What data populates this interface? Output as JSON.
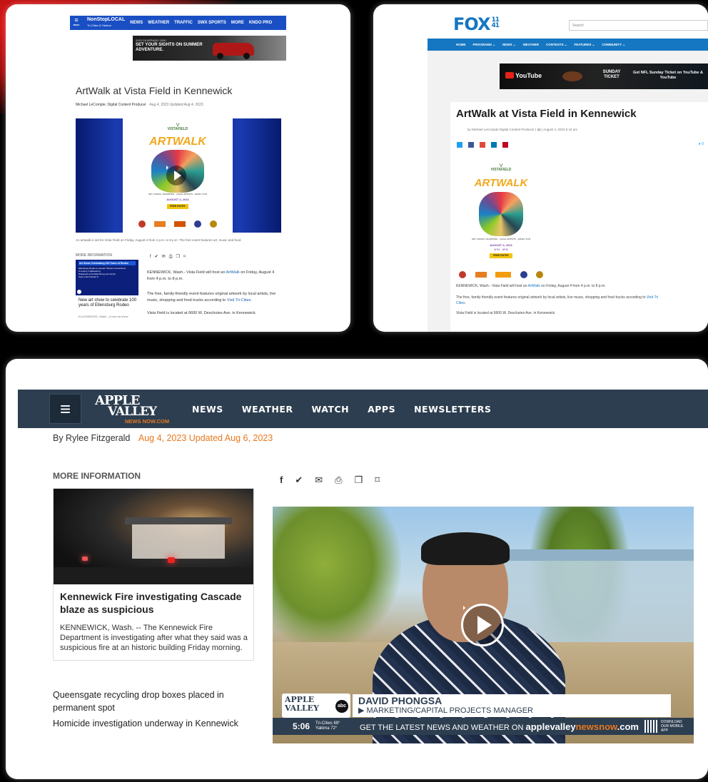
{
  "p1": {
    "menu_label": "MENU",
    "brand": "NonStopLOCAL",
    "brand_sub": "Tri-Cities & Yakima",
    "nav": [
      "NEWS",
      "WEATHER",
      "TRAFFIC",
      "SWX SPORTS",
      "MORE",
      "KNDO PRO"
    ],
    "ad_small": "2023 SILVERADO 1500",
    "ad_text": "SET YOUR SIGHTS ON SUMMER ADVENTURE.",
    "title": "ArtWalk at Vista Field in Kennewick",
    "byline": "Michael LeCompte, Digital Content Producer",
    "date": "Aug 4, 2023 Updated Aug 4, 2023",
    "caption": "An artwalk is set for Vista Field on Friday, August 4 from 4 p.m. to 8 p.m. The free event features art, music and food.",
    "more_info": "MORE INFORMATION",
    "side_title": "New art show to celebrate 100 years of Ellensburg Rodeo",
    "side_sub": "ELLENSBURG, Wash.- A new art show",
    "side_thumb_head": "Art Show Celebrating 100 Years of Rodeo",
    "side_thumb_lines": [
      "Ellensburg Rodeo to present 'Western Americana'",
      "A century in Ellensburg",
      "Displayed at the Ellensburg community",
      "Open until October 8"
    ],
    "body": [
      "KENNEWICK, Wash.- Vista Field will host an ",
      "ArtWalk",
      " on Friday, August 4 from 4 p.m. to 8 p.m."
    ],
    "body2": [
      "The free, family-friendly event features original artwork by local artists, live music, shopping and food trucks according to ",
      "Visit Tri-Cities",
      "."
    ],
    "body3": "Vista Field is located at 6600 W. Deschutes Ave. in Kennewick."
  },
  "poster": {
    "brand": "VISTAFIELD",
    "title": "ARTWALK",
    "lines": "ART | MUSIC | SHOPPING · LOCAL ARTISTS · FAMILY FUN",
    "date": "AUGUST 4, 2023",
    "time": "4PM - 8PM",
    "free": "FREE ENTRY"
  },
  "p2": {
    "logo": "FOX",
    "logo_num": "11 41",
    "search": "Search",
    "nav": [
      "HOME",
      "PROGRAMS ⌄",
      "NEWS ⌄",
      "WEATHER",
      "CONTESTS ⌄",
      "FEATURES ⌄",
      "COMMUNITY ⌄"
    ],
    "ad_yt": "YouTube",
    "ad_sunday": "SUNDAY TICKET",
    "ad_text": "Get NFL Sunday Ticket on YouTube & YouTube",
    "title": "ArtWalk at Vista Field in Kennewick",
    "byline": "by Michael LeCompte Digital Content Producer | 🕮 | August 4, 2023 5:42 am",
    "comments": "0",
    "body": [
      "KENNEWICK, Wash.- Vista Field will host an ",
      "ArtWalk",
      " on Friday, August 4 from 4 p.m. to 8 p.m."
    ],
    "body2": [
      "The free, family friendly event features original artwork by local artists, live music, shopping and food trucks according to ",
      "Visit Tri Cities",
      "."
    ],
    "body3": "Vista Field is located at 6600 W. Deschutes Ave. in Kennewick."
  },
  "p3": {
    "logo_top": "APPLE",
    "logo_mid": "VALLEY",
    "logo_bottom": "NEWS NOW.COM",
    "nav": [
      "NEWS",
      "WEATHER",
      "WATCH",
      "APPS",
      "NEWSLETTERS"
    ],
    "byline": "By Rylee Fitzgerald",
    "date": "Aug 4, 2023 Updated Aug 6, 2023",
    "more_info": "MORE INFORMATION",
    "card_title": "Kennewick Fire investigating Cascade blaze as suspicious",
    "card_body": "KENNEWICK, Wash. -- The Kennewick Fire Department is investigating after what they said was a suspicious fire at an historic building Friday morning.",
    "links": [
      "Queensgate recycling drop boxes placed in permanent spot",
      "Homicide investigation underway in Kennewick"
    ],
    "lower_name": "DAVID PHONGSA",
    "lower_role": "▶ MARKETING/CAPITAL PROJECTS MANAGER",
    "ticker_time": "5:06",
    "ticker_weather": "Tri-Cities 69° Yakima 72°",
    "ticker_text": "GET THE LATEST NEWS AND WEATHER ON ",
    "ticker_site_a": "applevalley",
    "ticker_site_b": "newsnow",
    "ticker_site_c": ".com",
    "ticker_app": "DOWNLOAD OUR MOBILE APP",
    "lower_logo": "APPLE VALLEY",
    "lower_abc": "abc"
  },
  "colors": {
    "kndo_blue": "#1a4fc4",
    "fox_blue": "#1577c2",
    "avnn_nav": "#2d3e50",
    "avnn_orange": "#e8781e",
    "link_blue": "#1a5fb4"
  },
  "icons": [
    "facebook-icon",
    "twitter-icon",
    "email-icon",
    "print-icon",
    "copy-icon",
    "bookmark-icon",
    "play-icon",
    "hamburger-icon"
  ]
}
